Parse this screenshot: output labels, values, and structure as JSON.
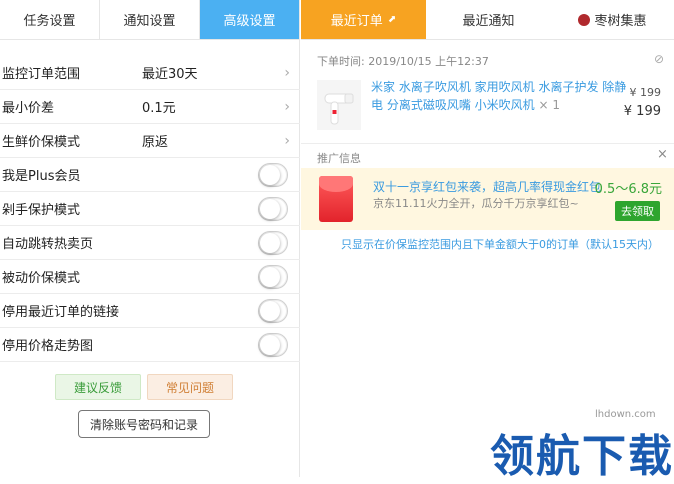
{
  "left_tabs": [
    "任务设置",
    "通知设置",
    "高级设置"
  ],
  "settings": {
    "rows": [
      {
        "label": "监控订单范围",
        "value": "最近30天"
      },
      {
        "label": "最小价差",
        "value": "0.1元"
      },
      {
        "label": "生鲜价保模式",
        "value": "原返"
      }
    ],
    "toggles": [
      {
        "label": "我是Plus会员",
        "on": false
      },
      {
        "label": "剁手保护模式",
        "on": false
      },
      {
        "label": "自动跳转热卖页",
        "on": false
      },
      {
        "label": "被动价保模式",
        "on": false
      },
      {
        "label": "停用最近订单的链接",
        "on": false
      },
      {
        "label": "停用价格走势图",
        "on": false
      }
    ]
  },
  "buttons": {
    "feedback": "建议反馈",
    "faq": "常见问题",
    "clear": "清除账号密码和记录"
  },
  "right_tabs": {
    "recent_orders": "最近订单",
    "recent_notices": "最近通知",
    "brand": "枣树集惠"
  },
  "order": {
    "time_label": "下单时间:",
    "time_value": "2019/10/15 上午12:37",
    "title": "米家 水离子吹风机 家用吹风机 水离子护发 除静电 分离式磁吸风嘴 小米吹风机",
    "qty": "× 1",
    "price_small": "¥ 199",
    "price": "¥ 199"
  },
  "promo": {
    "header": "推广信息",
    "close": "×",
    "title": "双十一京享红包来袭，超高几率得现金红包",
    "desc": "京东11.11火力全开，瓜分千万京享红包~",
    "range": "0.5～6.8元",
    "button": "去领取"
  },
  "footnote": "只显示在价保监控范围内且下单金额大于0的订单（默认15天内）",
  "watermark": {
    "url": "lhdown.com",
    "text": "领航下载"
  },
  "colors": {
    "blue_tab": "#4bb0f2",
    "orange_tab": "#f7a321",
    "link_blue": "#3a9be0",
    "green": "#2ea52e"
  }
}
